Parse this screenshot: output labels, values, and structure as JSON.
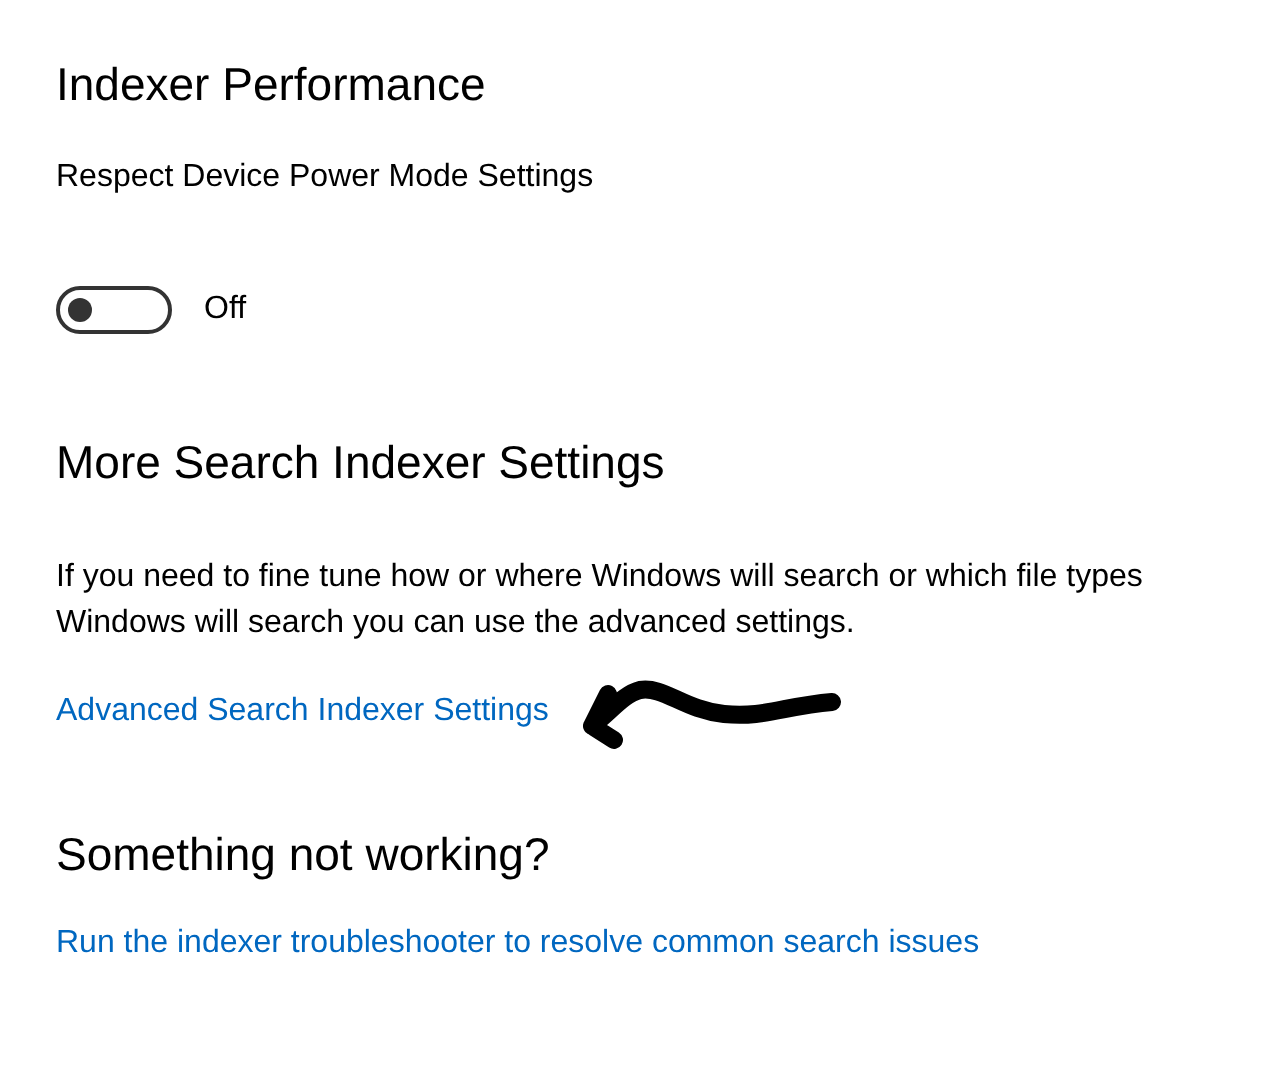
{
  "sections": [
    {
      "kind": "toggle",
      "heading": "Indexer Performance",
      "label": "Respect Device Power Mode Settings",
      "toggle": {
        "on": false,
        "state_text": "Off"
      }
    },
    {
      "kind": "link",
      "heading": "More Search Indexer Settings",
      "description": "If you need to fine tune how or where Windows will search or which file types Windows will search you can use the advanced settings.",
      "link": "Advanced Search Indexer Settings",
      "annotated": true
    },
    {
      "kind": "link",
      "heading": "Something not working?",
      "link": "Run the indexer troubleshooter to resolve common search issues",
      "annotated": false
    }
  ]
}
